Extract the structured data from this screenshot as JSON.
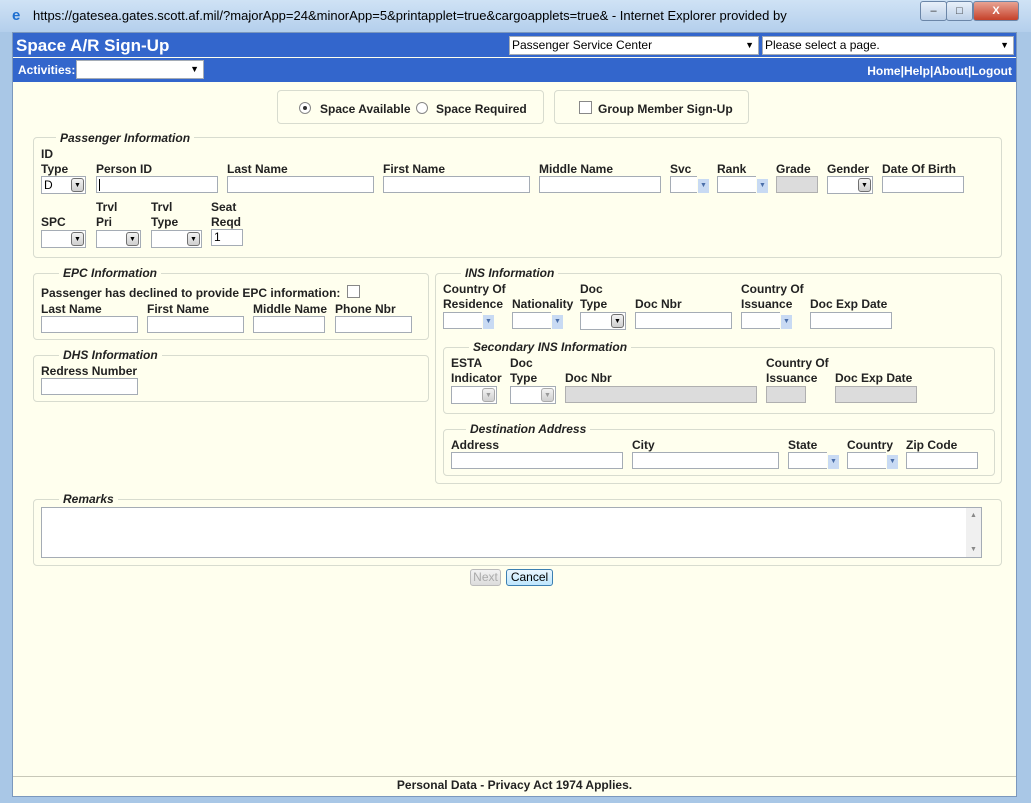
{
  "window": {
    "title": "https://gatesea.gates.scott.af.mil/?majorApp=24&minorApp=5&printapplet=true&cargoapplets=true&  - Internet Explorer provided by",
    "minimize": "–",
    "restore": "□",
    "close": "X"
  },
  "header": {
    "app_title": "Space A/R Sign-Up",
    "location_select": "Passenger Service Center",
    "page_select": "Please select a page.",
    "activities_label": "Activities:",
    "activities_value": "",
    "links": [
      "Home",
      "Help",
      "About",
      "Logout"
    ],
    "sep": "|"
  },
  "options": {
    "space_available": "Space Available",
    "space_required": "Space Required",
    "group_signup": "Group Member Sign-Up",
    "selected": "space_available"
  },
  "passenger": {
    "legend": "Passenger Information",
    "id_type": "ID\nType",
    "id_type_value": "D",
    "person_id": "Person ID",
    "last_name": "Last Name",
    "first_name": "First Name",
    "middle_name": "Middle Name",
    "svc": "Svc",
    "rank": "Rank",
    "grade": "Grade",
    "gender": "Gender",
    "dob": "Date Of Birth",
    "spc": "SPC",
    "trvl_pri": "Trvl\nPri",
    "trvl_type": "Trvl\nType",
    "seat_reqd": "Seat\nReqd",
    "seat_value": "1"
  },
  "epc": {
    "legend": "EPC Information",
    "declined": "Passenger has declined to provide EPC information:",
    "last_name": "Last Name",
    "first_name": "First Name",
    "middle_name": "Middle Name",
    "phone": "Phone Nbr"
  },
  "dhs": {
    "legend": "DHS Information",
    "redress": "Redress Number"
  },
  "ins": {
    "legend": "INS Information",
    "country_res": "Country Of\nResidence",
    "nationality": "Nationality",
    "doc_type": "Doc\nType",
    "doc_nbr": "Doc Nbr",
    "country_iss": "Country Of\nIssuance",
    "doc_exp": "Doc Exp Date"
  },
  "secondary": {
    "legend": "Secondary INS Information",
    "esta": "ESTA\nIndicator",
    "doc_type": "Doc\nType",
    "doc_nbr": "Doc Nbr",
    "country_iss": "Country Of\nIssuance",
    "doc_exp": "Doc Exp Date"
  },
  "destination": {
    "legend": "Destination Address",
    "address": "Address",
    "city": "City",
    "state": "State",
    "country": "Country",
    "zip": "Zip Code"
  },
  "remarks": {
    "legend": "Remarks"
  },
  "buttons": {
    "next": "Next",
    "cancel": "Cancel"
  },
  "footer": "Personal Data - Privacy Act 1974 Applies."
}
